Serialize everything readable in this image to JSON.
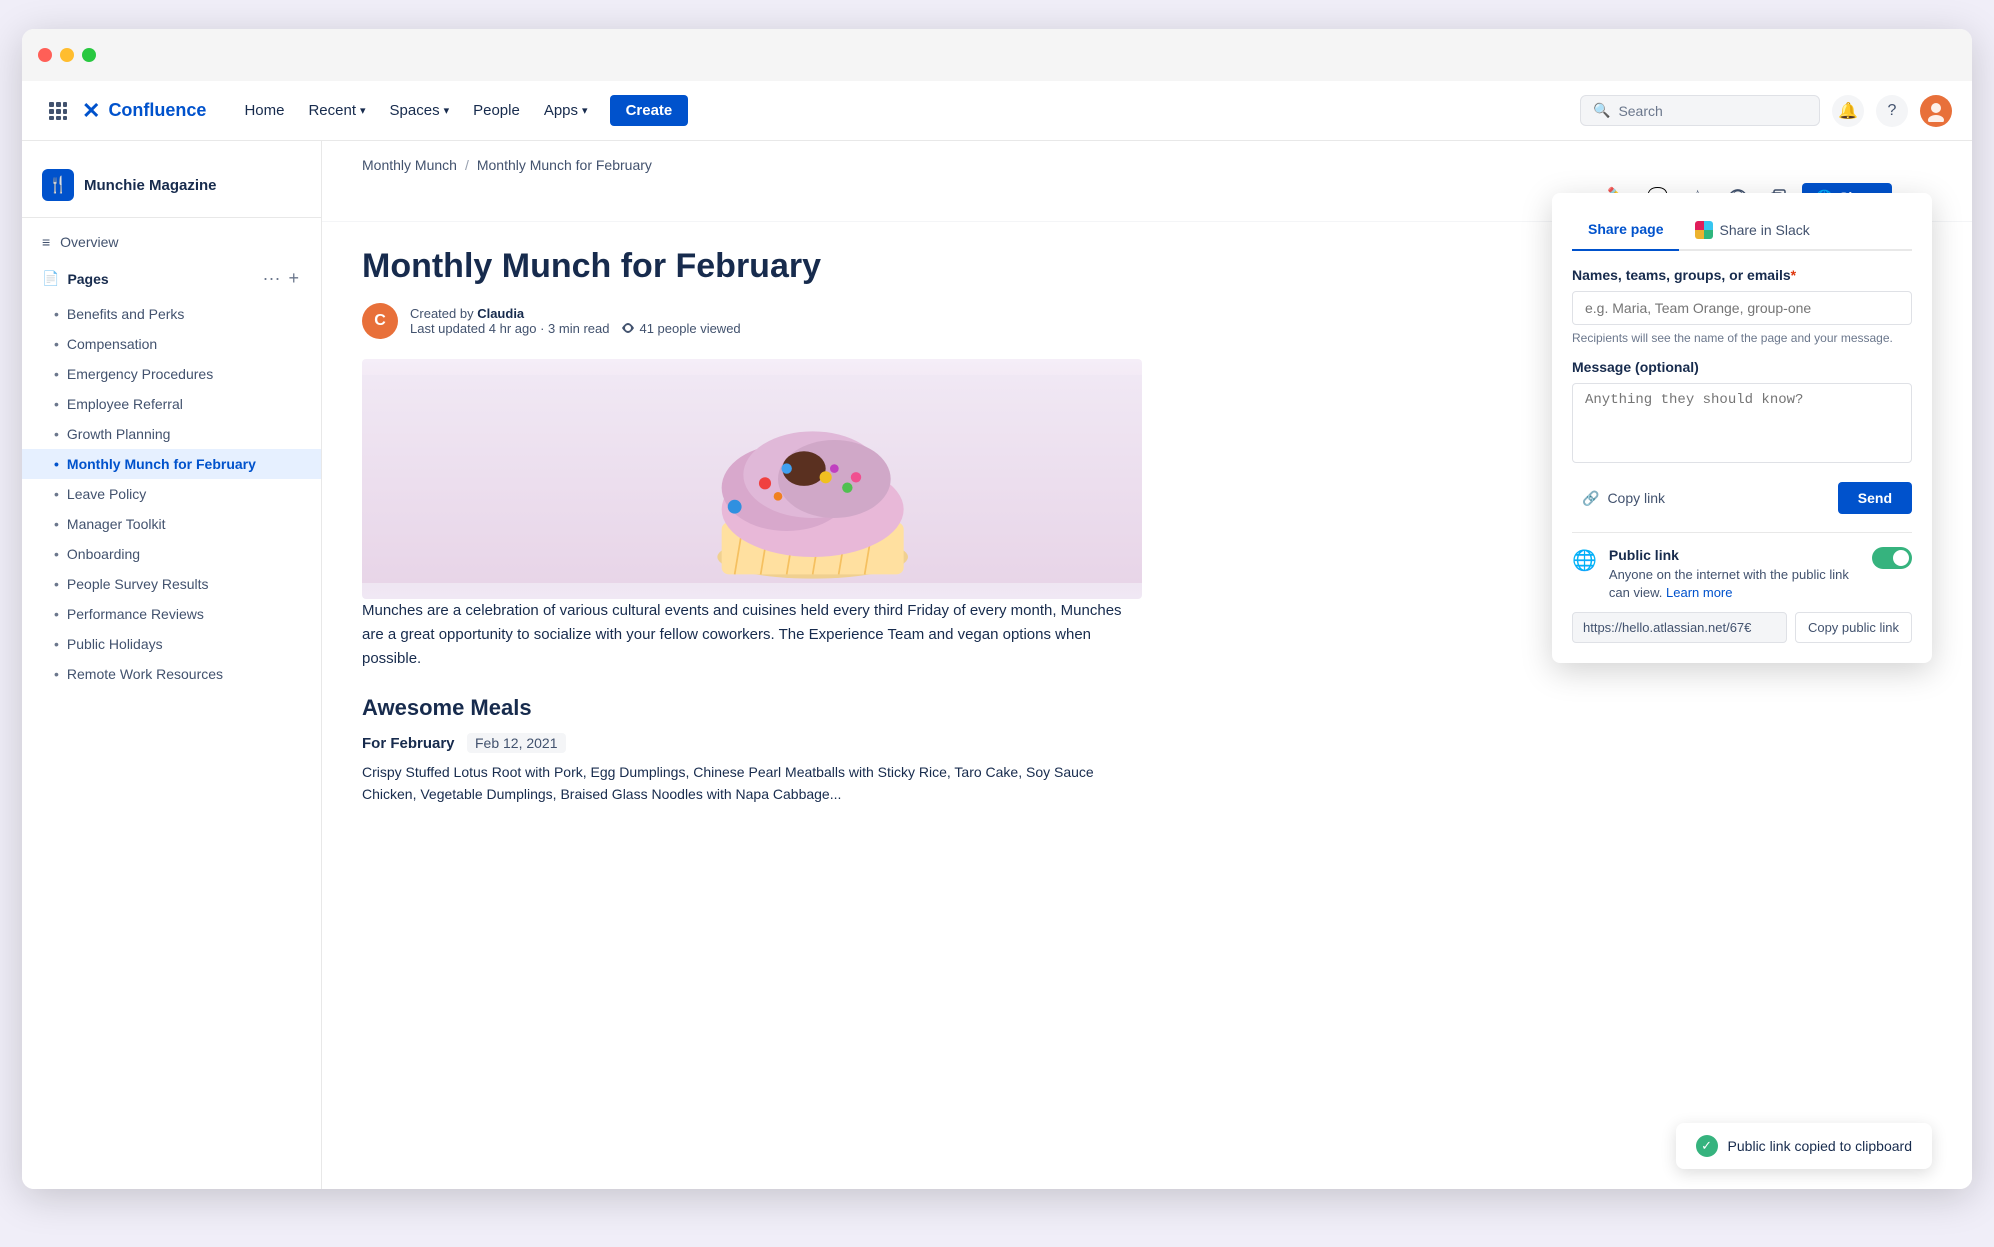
{
  "window": {
    "dots": [
      "red",
      "yellow",
      "green"
    ]
  },
  "navbar": {
    "logo_text": "Confluence",
    "links": [
      {
        "label": "Home",
        "has_chevron": false
      },
      {
        "label": "Recent",
        "has_chevron": true
      },
      {
        "label": "Spaces",
        "has_chevron": true
      },
      {
        "label": "People",
        "has_chevron": false
      },
      {
        "label": "Apps",
        "has_chevron": true
      }
    ],
    "create_label": "Create",
    "search_placeholder": "Search"
  },
  "sidebar": {
    "space_name": "Munchie Magazine",
    "overview_label": "Overview",
    "pages_label": "Pages",
    "items": [
      {
        "label": "Benefits and Perks",
        "active": false
      },
      {
        "label": "Compensation",
        "active": false
      },
      {
        "label": "Emergency Procedures",
        "active": false
      },
      {
        "label": "Employee Referral",
        "active": false
      },
      {
        "label": "Growth Planning",
        "active": false
      },
      {
        "label": "Monthly Munch for February",
        "active": true
      },
      {
        "label": "Leave Policy",
        "active": false
      },
      {
        "label": "Manager Toolkit",
        "active": false
      },
      {
        "label": "Onboarding",
        "active": false
      },
      {
        "label": "People Survey Results",
        "active": false
      },
      {
        "label": "Performance Reviews",
        "active": false
      },
      {
        "label": "Public Holidays",
        "active": false
      },
      {
        "label": "Remote Work Resources",
        "active": false
      }
    ]
  },
  "breadcrumb": {
    "parent": "Monthly Munch",
    "current": "Monthly Munch for February"
  },
  "page": {
    "title": "Monthly Munch for February",
    "author": "Claudia",
    "meta": "Last updated 4 hr ago · 3 min read",
    "views": "41 people viewed",
    "body": "Munches are a celebration of various cultural events and cuisines held every third Friday of every month, Munches are a great opportunity to socialize with your fellow coworkers. The Experience Team and vegan options when possible.",
    "section_title": "Awesome Meals",
    "for_label": "For February",
    "date": "Feb 12, 2021",
    "meals_text": "Crispy Stuffed Lotus Root with Pork, Egg Dumplings, Chinese Pearl Meatballs with Sticky Rice, Taro Cake, Soy Sauce Chicken, Vegetable Dumplings, Braised Glass Noodles with Napa Cabbage..."
  },
  "share_panel": {
    "tab_page": "Share page",
    "tab_slack": "Share in Slack",
    "names_label": "Names, teams, groups, or emails",
    "names_placeholder": "e.g. Maria, Team Orange, group-one",
    "names_hint": "Recipients will see the name of the page and your message.",
    "message_label": "Message (optional)",
    "message_placeholder": "Anything they should know?",
    "copy_link_label": "Copy link",
    "send_label": "Send",
    "public_link_title": "Public link",
    "public_link_desc": "Anyone on the internet with the public link can view.",
    "learn_more": "Learn more",
    "public_url": "https://hello.atlassian.net/67€",
    "copy_public_label": "Copy public link"
  },
  "toast": {
    "message": "Public link copied to clipboard"
  },
  "toolbar": {
    "share_label": "Share",
    "more_label": "···"
  }
}
